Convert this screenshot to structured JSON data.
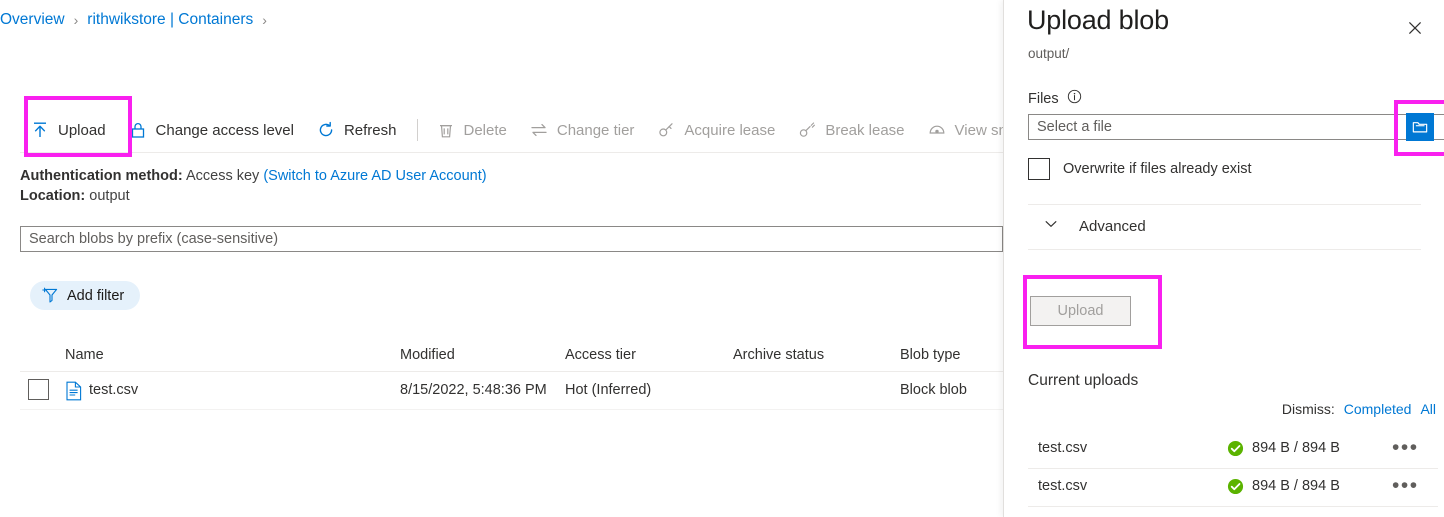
{
  "breadcrumb": {
    "items": [
      {
        "label": "Overview"
      },
      {
        "label": "rithwikstore | Containers"
      }
    ],
    "separator": "›"
  },
  "toolbar": {
    "items": [
      {
        "label": "Upload",
        "icon": "upload-icon",
        "enabled": true
      },
      {
        "label": "Change access level",
        "icon": "lock-icon",
        "enabled": true
      },
      {
        "label": "Refresh",
        "icon": "refresh-icon",
        "enabled": true
      },
      {
        "label": "Delete",
        "icon": "trash-icon",
        "enabled": false
      },
      {
        "label": "Change tier",
        "icon": "swap-icon",
        "enabled": false
      },
      {
        "label": "Acquire lease",
        "icon": "lease-icon",
        "enabled": false
      },
      {
        "label": "Break lease",
        "icon": "break-lease-icon",
        "enabled": false
      },
      {
        "label": "View sna",
        "icon": "snapshot-icon",
        "enabled": false
      }
    ]
  },
  "info": {
    "auth_label": "Authentication method:",
    "auth_value": "Access key",
    "auth_switch_link": "(Switch to Azure AD User Account)",
    "location_label": "Location:",
    "location_value": "output"
  },
  "search": {
    "placeholder": "Search blobs by prefix (case-sensitive)",
    "value": ""
  },
  "filter": {
    "add_label": "Add filter",
    "icon": "add-filter-icon"
  },
  "table": {
    "columns": [
      "Name",
      "Modified",
      "Access tier",
      "Archive status",
      "Blob type"
    ],
    "rows": [
      {
        "name": "test.csv",
        "modified": "8/15/2022, 5:48:36 PM",
        "access_tier": "Hot (Inferred)",
        "archive_status": "",
        "blob_type": "Block blob",
        "icon": "csv-file-icon",
        "selected": false
      }
    ]
  },
  "panel": {
    "title": "Upload blob",
    "subtitle": "output/",
    "close_icon": "close-icon",
    "files": {
      "label": "Files",
      "info_icon": "info-icon",
      "placeholder": "Select a file",
      "value": "",
      "browse_icon": "folder-open-icon"
    },
    "overwrite": {
      "label": "Overwrite if files already exist",
      "checked": false
    },
    "advanced": {
      "label": "Advanced",
      "chevron_icon": "chevron-down-icon",
      "expanded": false
    },
    "upload_button": {
      "label": "Upload",
      "enabled": false
    },
    "current_uploads": {
      "title": "Current uploads",
      "dismiss_label": "Dismiss:",
      "dismiss_completed": "Completed",
      "dismiss_all": "All",
      "items": [
        {
          "name": "test.csv",
          "size": "894 B / 894 B",
          "status": "completed",
          "status_icon": "success-check-icon",
          "more_icon": "more-icon",
          "more_label": "•••"
        },
        {
          "name": "test.csv",
          "size": "894 B / 894 B",
          "status": "completed",
          "status_icon": "success-check-icon",
          "more_icon": "more-icon",
          "more_label": "•••"
        }
      ]
    }
  },
  "annotations": {
    "color": "#f920ef",
    "boxes": [
      {
        "target": "toolbar-upload-button"
      },
      {
        "target": "files-browse-button"
      },
      {
        "target": "panel-upload-button"
      }
    ]
  },
  "colors": {
    "accent": "#0078d4",
    "link": "#0078d4",
    "success": "#5bb300",
    "annotation": "#f920ef",
    "disabled_text": "#a19f9d"
  }
}
